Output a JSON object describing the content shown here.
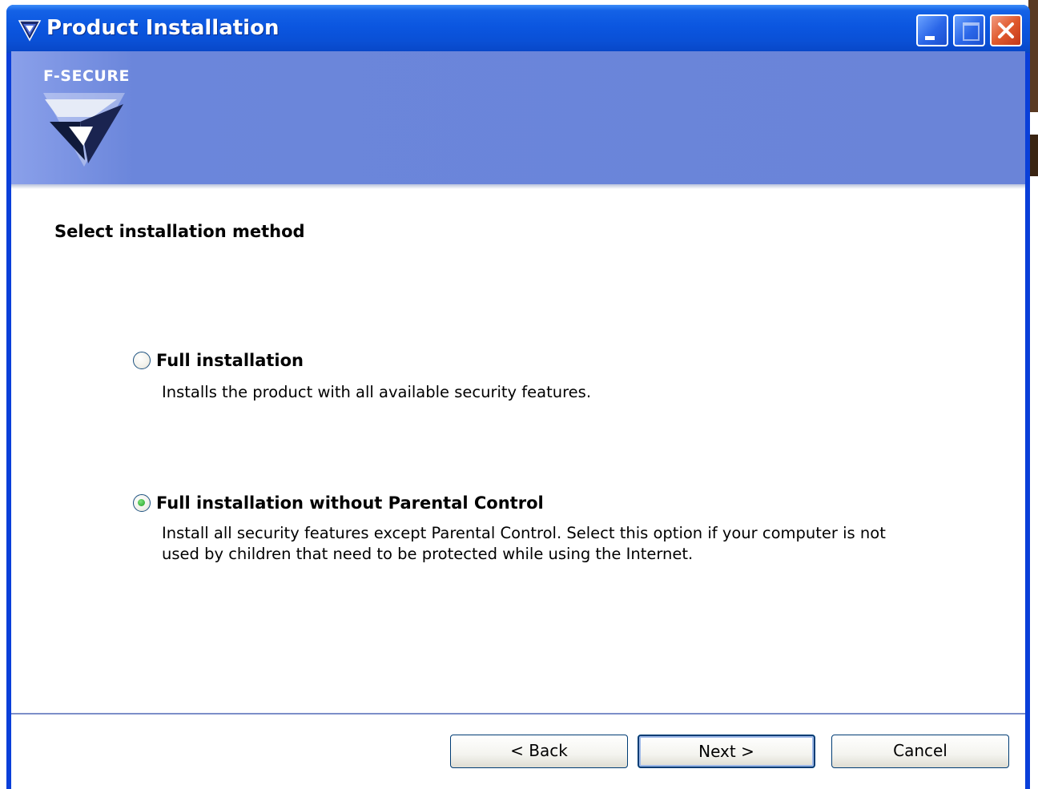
{
  "window": {
    "title": "Product Installation"
  },
  "banner": {
    "logo_text": "F-SECURE"
  },
  "page": {
    "heading": "Select installation method",
    "options": [
      {
        "label": "Full installation",
        "description": "Installs the product with all available security features.",
        "selected": false
      },
      {
        "label": "Full installation without Parental Control",
        "description": "Install all security features except Parental Control. Select this option if your computer is not used by children that need to be protected while using the Internet.",
        "selected": true
      }
    ]
  },
  "buttons": {
    "back": "< Back",
    "next": "Next >",
    "cancel": "Cancel"
  },
  "colors": {
    "titlebar": "#0b56e0",
    "banner": "#6a84d8",
    "radio_selected": "#21a121"
  },
  "icons": {
    "app": "f-secure-logo-icon",
    "minimize": "minimize-icon",
    "maximize": "maximize-icon",
    "close": "close-icon"
  }
}
